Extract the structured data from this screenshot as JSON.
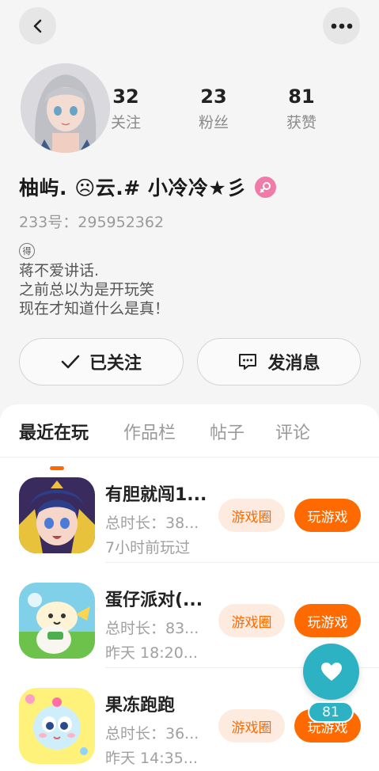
{
  "header": {
    "back_icon": "chevron-left-icon",
    "more_icon": "more-dots-icon"
  },
  "profile": {
    "name": "柚屿. ☹云.# 小冷冷★彡",
    "gender_icon": "female-icon",
    "gender_color": "#f07aa8",
    "uid": "233号：295952362",
    "badge": "得",
    "bio_lines": [
      "蒋不爱讲话.",
      "之前总以为是开玩笑",
      "现在才知道什么是真！"
    ],
    "stats": [
      {
        "value": "32",
        "label": "关注"
      },
      {
        "value": "23",
        "label": "粉丝"
      },
      {
        "value": "81",
        "label": "获赞"
      }
    ]
  },
  "actions": {
    "follow_label": "已关注",
    "message_label": "发消息"
  },
  "tabs": [
    "最近在玩",
    "作品栏",
    "帖子",
    "评论"
  ],
  "accent_color": "#ff6a00",
  "games": [
    {
      "title": "有胆就闯1...",
      "duration": "总时长：38...",
      "last_played": "7小时前玩过",
      "circle_label": "游戏圈",
      "play_label": "玩游戏"
    },
    {
      "title": "蛋仔派对(...",
      "duration": "总时长：83...",
      "last_played": "昨天 18:20...",
      "circle_label": "游戏圈",
      "play_label": "玩游戏"
    },
    {
      "title": "果冻跑跑",
      "duration": "总时长：36...",
      "last_played": "昨天 14:35...",
      "circle_label": "游戏圈",
      "play_label": "玩游戏"
    }
  ],
  "like_fab": {
    "icon": "heart-icon",
    "count": "81",
    "color": "#2cb2c2"
  }
}
